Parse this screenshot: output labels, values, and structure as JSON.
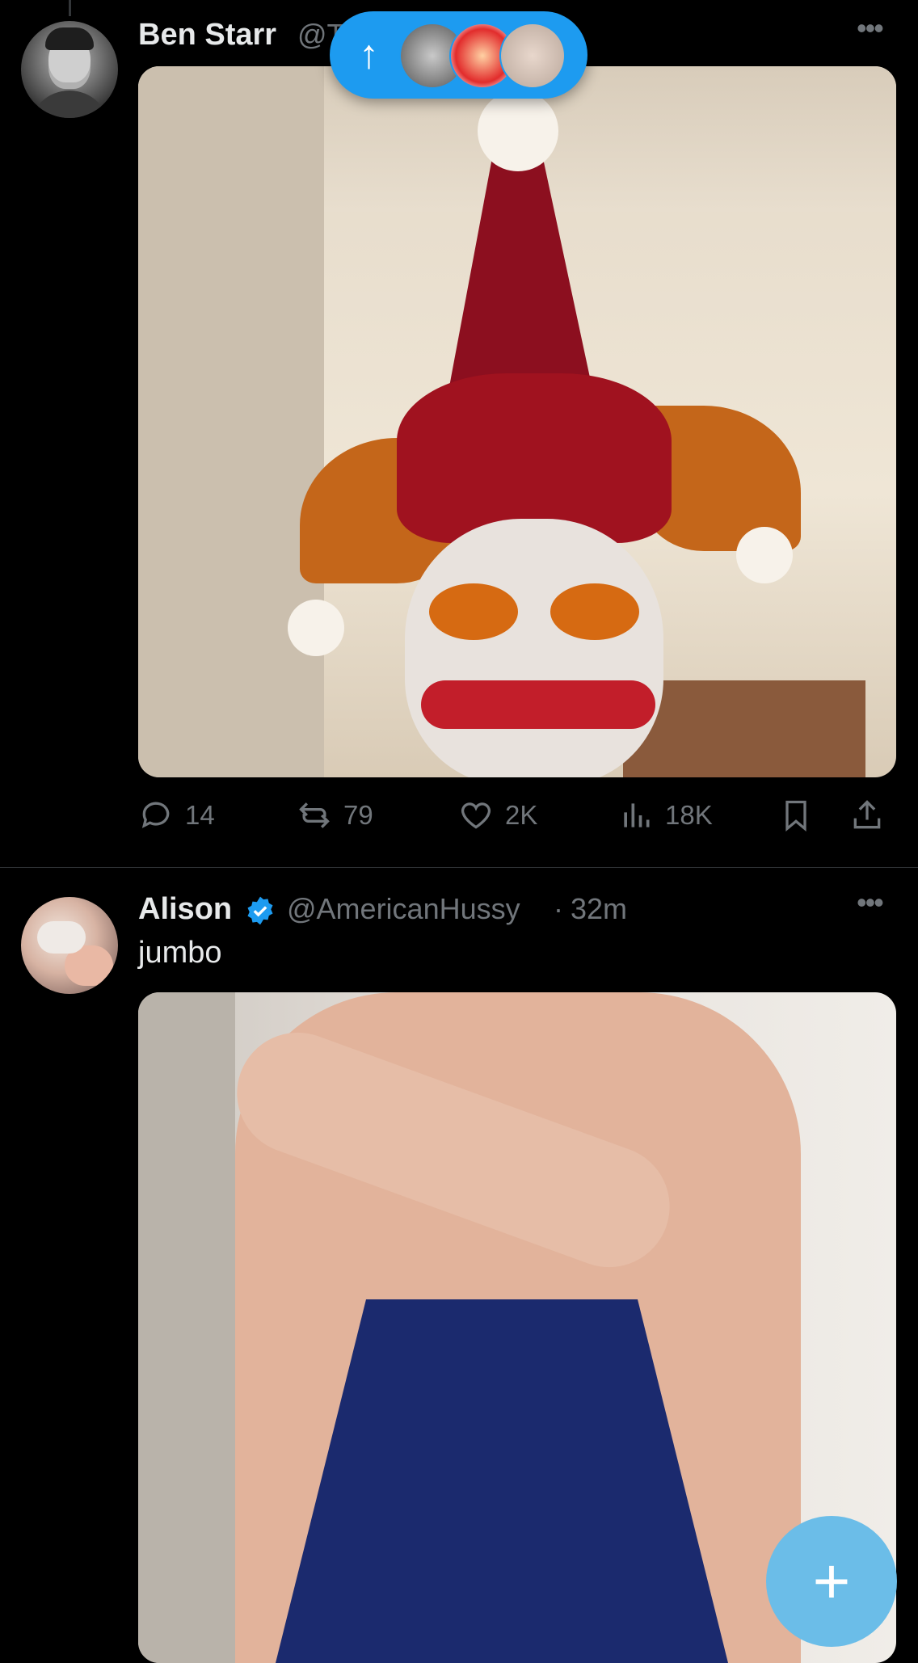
{
  "post1": {
    "author_name": "Ben Starr",
    "handle_partial": "@T",
    "stats": {
      "replies": "14",
      "reposts": "79",
      "likes": "2K",
      "views": "18K"
    }
  },
  "post2": {
    "author_name": "Alison",
    "handle": "@AmericanHussy",
    "separator": "·",
    "time": "32m",
    "text": "jumbo"
  },
  "new_posts_pill": {
    "arrow": "↑"
  },
  "fab": {
    "label": "+"
  },
  "colors": {
    "accent": "#1d9bf0",
    "background": "#000000",
    "secondary_text": "#71767b"
  }
}
